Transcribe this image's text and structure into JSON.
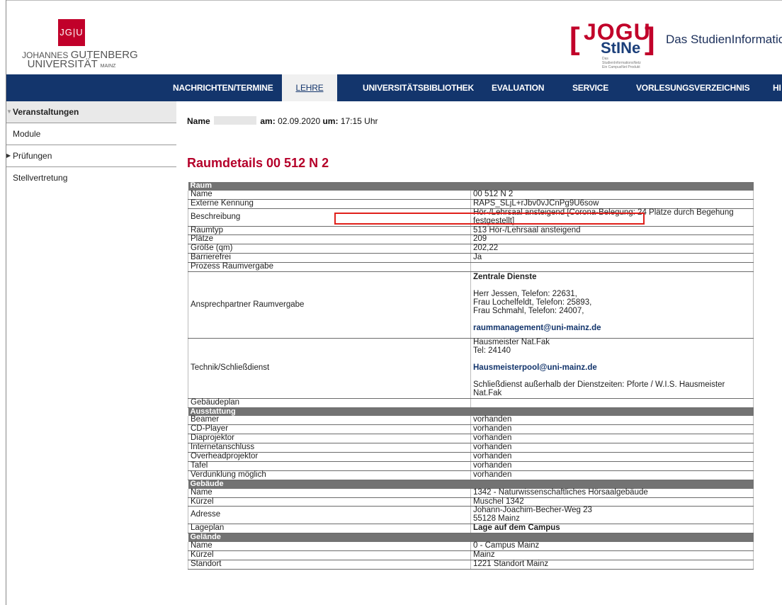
{
  "header": {
    "jgu_logo": {
      "mark": "JG|U",
      "line1_prefix": "JOHANNES",
      "line1_name": "GUTENBERG",
      "line2_name": "UNIVERSITÄT",
      "line2_suffix": "MAINZ"
    },
    "jogu_logo": {
      "line1": "JOGU",
      "line2": "StINe",
      "subtitle": "Das StudienInformationsNetz Ein CampusNet Produkt"
    },
    "site_title": "Das StudienInformatio"
  },
  "nav": {
    "items": [
      {
        "label": "NACHRICHTEN/TERMINE"
      },
      {
        "label": "LEHRE",
        "active": true
      },
      {
        "label": "UNIVERSITÄTSBIBLIOTHEK"
      },
      {
        "label": "EVALUATION"
      },
      {
        "label": "SERVICE"
      },
      {
        "label": "VORLESUNGSVERZEICHNIS"
      },
      {
        "label": "HI"
      }
    ]
  },
  "sidebar": {
    "items": [
      {
        "label": "Veranstaltungen"
      },
      {
        "label": "Module"
      },
      {
        "label": "Prüfungen"
      },
      {
        "label": "Stellvertretung"
      }
    ]
  },
  "meta": {
    "name_label": "Name",
    "date_label": "am:",
    "date": "02.09.2020",
    "time_label": "um:",
    "time": "17:15 Uhr"
  },
  "page_title": "Raumdetails 00 512 N 2",
  "room": {
    "section": "Raum",
    "rows": [
      {
        "k": "Name",
        "v": "00 512 N 2"
      },
      {
        "k": "Externe Kennung",
        "v": "RAPS_SLjL+rJbv0vJCnPg9U6sow"
      },
      {
        "k": "Beschreibung",
        "v": "Hör-/Lehrsaal ansteigend [Corona-Belegung: 24 Plätze durch Begehung festgestellt]"
      },
      {
        "k": "Raumtyp",
        "v": "513 Hör-/Lehrsaal ansteigend"
      },
      {
        "k": "Plätze",
        "v": "209"
      },
      {
        "k": "Größe (qm)",
        "v": "202,22"
      },
      {
        "k": "Barrierefrei",
        "v": "Ja"
      },
      {
        "k": "Prozess Raumvergabe",
        "v": ""
      }
    ],
    "contact": {
      "k": "Ansprechpartner Raumvergabe",
      "heading": "Zentrale Dienste",
      "line1": "Herr Jessen, Telefon: 22631,",
      "line2": "Frau Lochelfeldt, Telefon: 25893,",
      "line3": "Frau Schmahl, Telefon: 24007,",
      "email": "raummanagement@uni-mainz.de"
    },
    "tech": {
      "k": "Technik/Schließdienst",
      "line1": "Hausmeister Nat.Fak",
      "line2": "Tel: 24140",
      "email": "Hausmeisterpool@uni-mainz.de",
      "line3": "Schließdienst außerhalb der Dienstzeiten: Pforte / W.I.S. Hausmeister Nat.Fak"
    },
    "plan_row": {
      "k": "Gebäudeplan",
      "v": ""
    }
  },
  "equipment": {
    "section": "Ausstattung",
    "rows": [
      {
        "k": "Beamer",
        "v": "vorhanden"
      },
      {
        "k": "CD-Player",
        "v": "vorhanden"
      },
      {
        "k": "Diaprojektor",
        "v": "vorhanden"
      },
      {
        "k": "Internetanschluss",
        "v": "vorhanden"
      },
      {
        "k": "Overheadprojektor",
        "v": "vorhanden"
      },
      {
        "k": "Tafel",
        "v": "vorhanden"
      },
      {
        "k": "Verdunklung möglich",
        "v": "vorhanden"
      }
    ]
  },
  "building": {
    "section": "Gebäude",
    "name": {
      "k": "Name",
      "v": "1342 - Naturwissenschaftliches Hörsaalgebäude"
    },
    "short": {
      "k": "Kürzel",
      "v": "Muschel 1342"
    },
    "address": {
      "k": "Adresse",
      "line1": "Johann-Joachim-Becher-Weg 23",
      "line2": "55128 Mainz"
    },
    "map": {
      "k": "Lageplan",
      "v": "Lage auf dem Campus"
    }
  },
  "area": {
    "section": "Gelände",
    "rows": [
      {
        "k": "Name",
        "v": "0 - Campus Mainz"
      },
      {
        "k": "Kürzel",
        "v": "Mainz"
      },
      {
        "k": "Standort",
        "v": "1221 Standort Mainz"
      }
    ]
  },
  "colors": {
    "nav_bg": "#13356c",
    "title_red": "#b5002a",
    "section_bg": "#737373",
    "highlight": "#e0201b"
  }
}
